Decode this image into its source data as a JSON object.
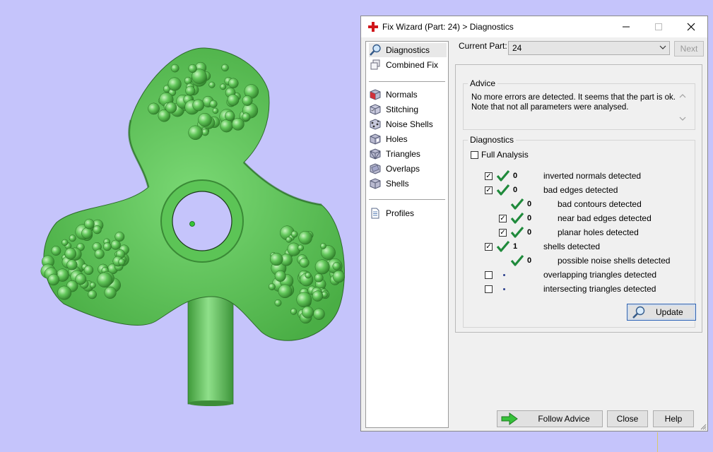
{
  "colors": {
    "background": "#c5c4fb",
    "model_green": "#6ad46a",
    "check_green": "#1f8a3b",
    "accent_red": "#d0161b"
  },
  "dialog": {
    "title": "Fix Wizard (Part: 24) > Diagnostics",
    "app_icon": "red-cross-icon"
  },
  "nav": {
    "items": [
      {
        "label": "Diagnostics",
        "icon": "magnifier-icon"
      },
      {
        "label": "Combined Fix",
        "icon": "cube-stack-icon"
      },
      {
        "label": "Normals",
        "icon": "normals-cube-icon"
      },
      {
        "label": "Stitching",
        "icon": "stitching-cube-icon"
      },
      {
        "label": "Noise Shells",
        "icon": "noise-shells-icon"
      },
      {
        "label": "Holes",
        "icon": "holes-cube-icon"
      },
      {
        "label": "Triangles",
        "icon": "triangles-cube-icon"
      },
      {
        "label": "Overlaps",
        "icon": "overlaps-cube-icon"
      },
      {
        "label": "Shells",
        "icon": "shells-cube-icon"
      },
      {
        "label": "Profiles",
        "icon": "document-icon"
      }
    ]
  },
  "header": {
    "current_part_label": "Current Part:",
    "current_part_value": "24",
    "next_label": "Next"
  },
  "advice": {
    "label": "Advice",
    "text_line1": "No more errors are detected. It seems that the part is ok.",
    "text_line2": "Note that not all parameters were analysed."
  },
  "diagnostics": {
    "label": "Diagnostics",
    "full_analysis_label": "Full Analysis",
    "full_analysis_checked": false,
    "rows": [
      {
        "label": "inverted normals detected",
        "count": "0",
        "checked": true
      },
      {
        "label": "bad edges detected",
        "count": "0",
        "checked": true
      },
      {
        "label": "bad contours detected",
        "count": "0"
      },
      {
        "label": "near bad edges detected",
        "count": "0",
        "checked": true
      },
      {
        "label": "planar holes detected",
        "count": "0",
        "checked": true
      },
      {
        "label": "shells detected",
        "count": "1",
        "checked": true
      },
      {
        "label": "possible noise shells detected",
        "count": "0"
      },
      {
        "label": "overlapping triangles detected",
        "checked": false
      },
      {
        "label": "intersecting triangles detected",
        "checked": false
      }
    ],
    "update_label": "Update"
  },
  "footer": {
    "follow_advice_label": "Follow Advice",
    "close_label": "Close",
    "help_label": "Help"
  }
}
